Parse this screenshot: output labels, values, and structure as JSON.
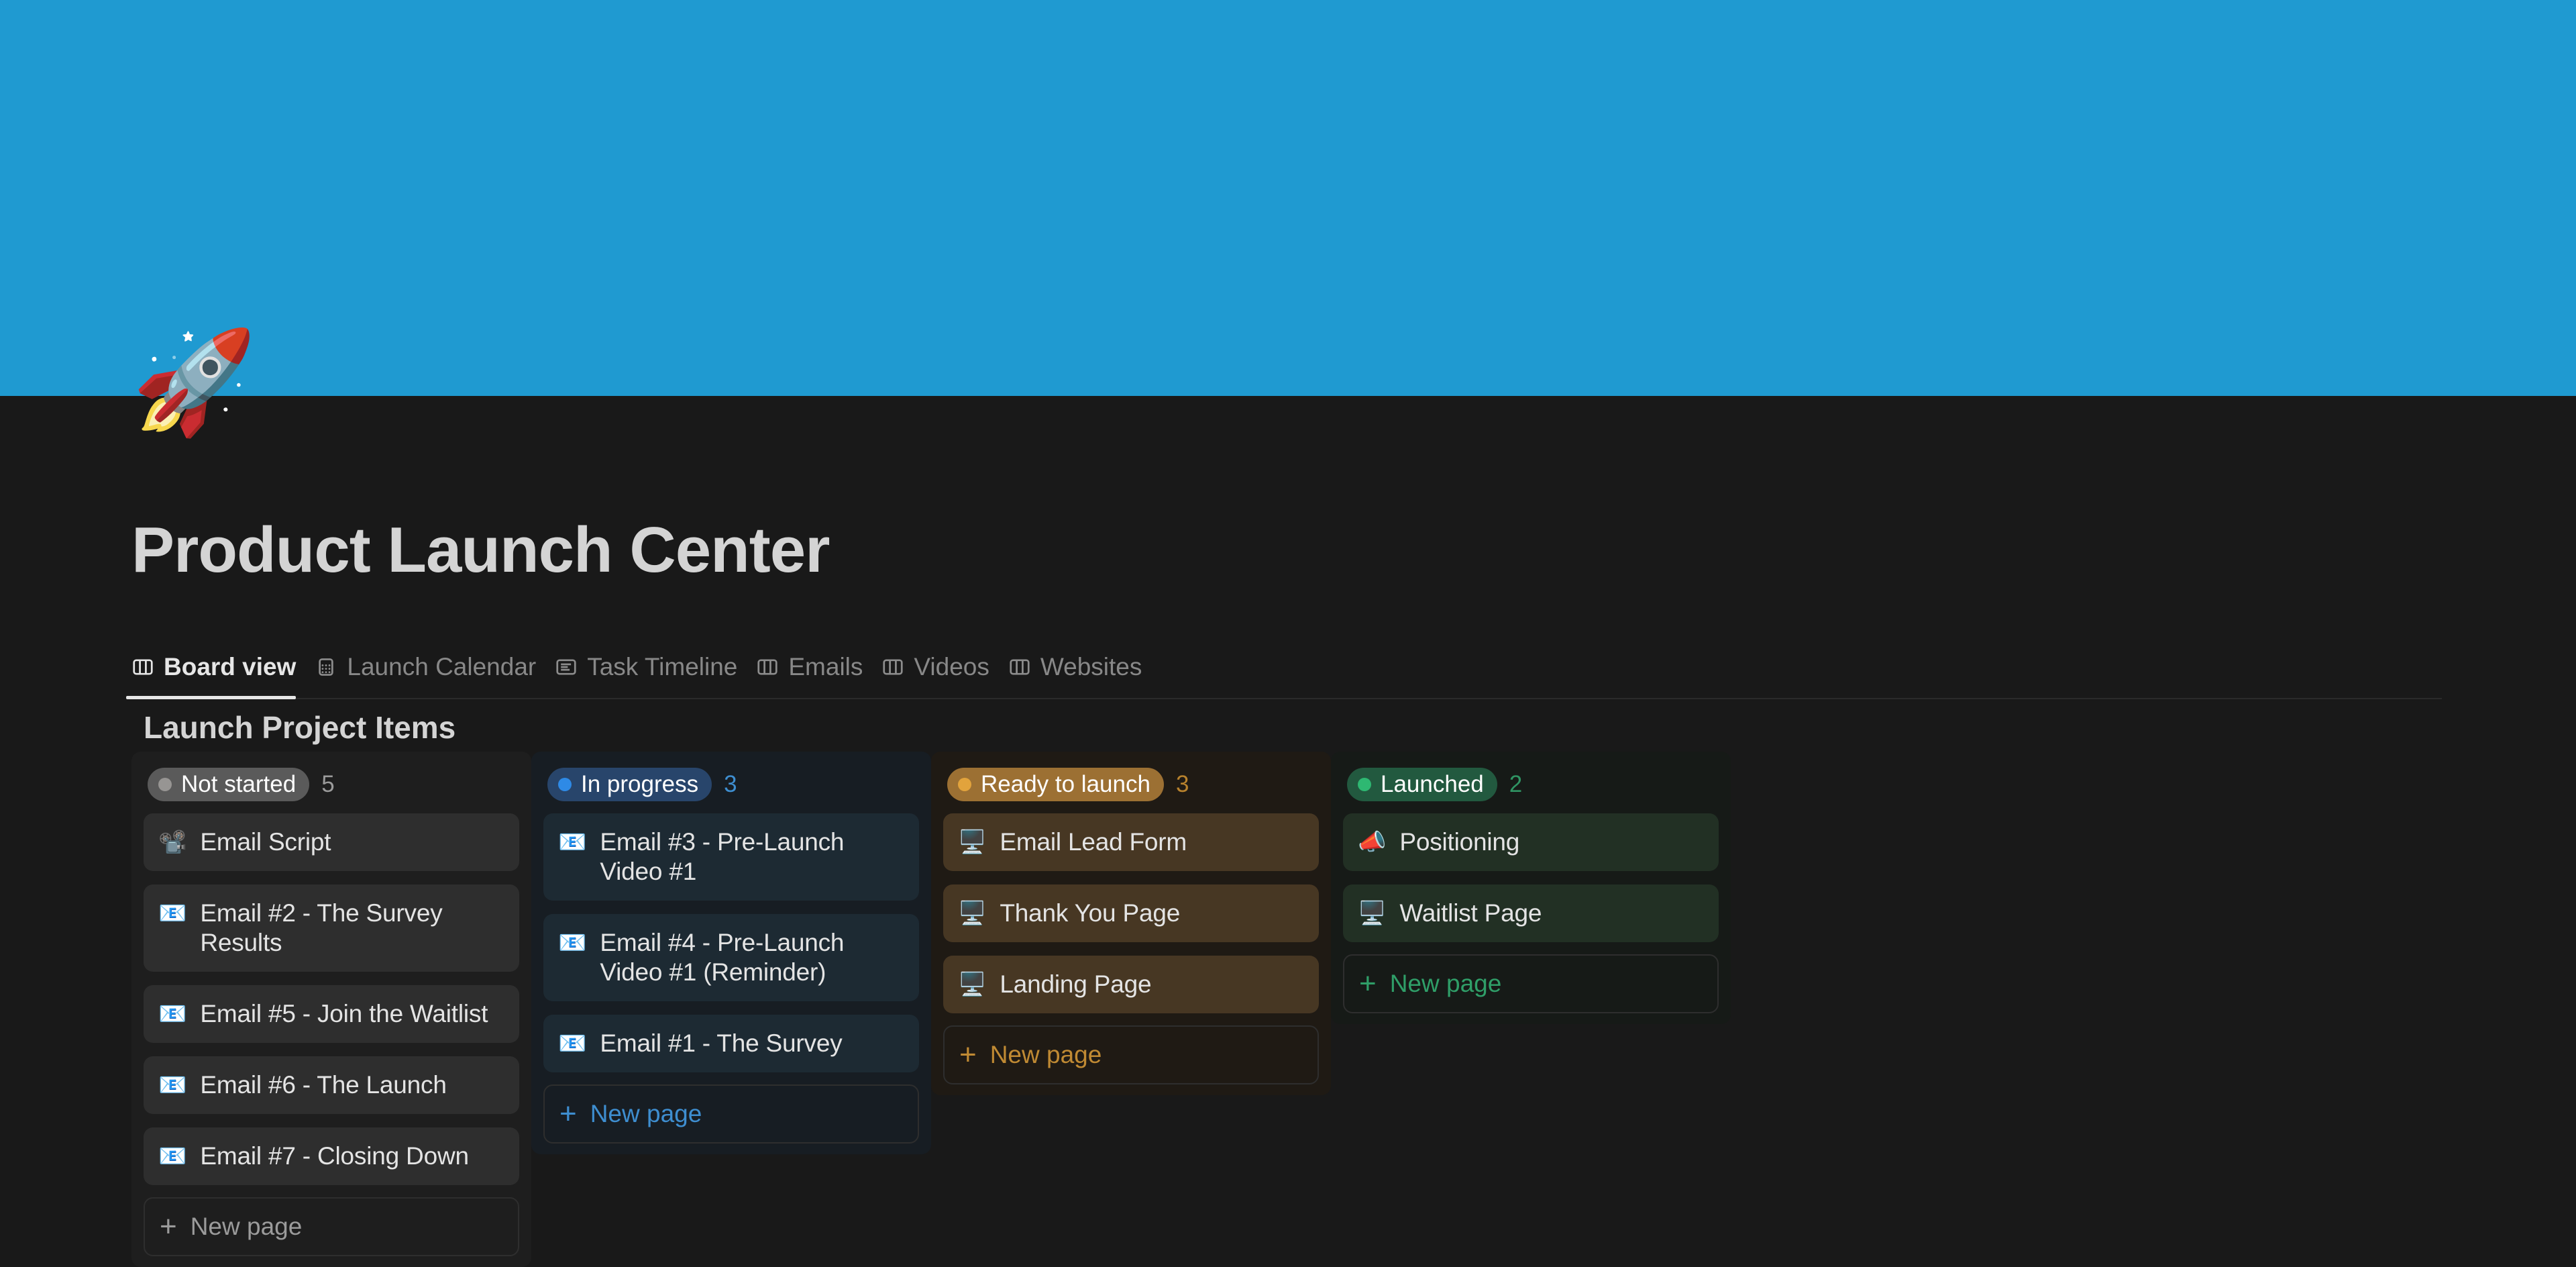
{
  "cover": {
    "color": "#1f9ad1"
  },
  "page": {
    "icon": "🚀",
    "icon_name": "rocket-emoji",
    "title": "Product Launch Center"
  },
  "tabs": [
    {
      "label": "Board view",
      "icon": "board-view-icon",
      "active": true
    },
    {
      "label": "Launch Calendar",
      "icon": "calendar-icon",
      "active": false
    },
    {
      "label": "Task Timeline",
      "icon": "timeline-icon",
      "active": false
    },
    {
      "label": "Emails",
      "icon": "board-view-icon",
      "active": false
    },
    {
      "label": "Videos",
      "icon": "board-view-icon",
      "active": false
    },
    {
      "label": "Websites",
      "icon": "board-view-icon",
      "active": false
    }
  ],
  "board": {
    "title": "Launch Project Items",
    "columns": [
      {
        "status": "Not started",
        "count": "5",
        "dot_color": "#979593",
        "pill_bg": "#5a5a5a",
        "pill_text": "#ffffff",
        "count_color": "#9b9b9b",
        "column_bg": "#1e1e1e",
        "card_bg": "#2e2e2e",
        "newpage_color": "#9b9b9b",
        "newpage_label": "New page",
        "cards": [
          {
            "emoji": "📽️",
            "icon_name": "film-projector-emoji",
            "title": "Email Script"
          },
          {
            "emoji": "📧",
            "icon_name": "email-emoji",
            "title": "Email #2 - The Survey Results"
          },
          {
            "emoji": "📧",
            "icon_name": "email-emoji",
            "title": "Email #5 - Join the Waitlist"
          },
          {
            "emoji": "📧",
            "icon_name": "email-emoji",
            "title": "Email #6 - The Launch"
          },
          {
            "emoji": "📧",
            "icon_name": "email-emoji",
            "title": "Email #7 - Closing Down"
          }
        ]
      },
      {
        "status": "In progress",
        "count": "3",
        "dot_color": "#2e8ae6",
        "pill_bg": "#28456b",
        "pill_text": "#ffffff",
        "count_color": "#3e8ed0",
        "column_bg": "#171d23",
        "card_bg": "#1d2a33",
        "newpage_color": "#3e8ed0",
        "newpage_label": "New page",
        "cards": [
          {
            "emoji": "📧",
            "icon_name": "email-emoji",
            "title": "Email #3 - Pre-Launch Video #1"
          },
          {
            "emoji": "📧",
            "icon_name": "email-emoji",
            "title": "Email #4 - Pre-Launch Video #1 (Reminder)"
          },
          {
            "emoji": "📧",
            "icon_name": "email-emoji",
            "title": "Email #1 - The Survey"
          }
        ]
      },
      {
        "status": "Ready to launch",
        "count": "3",
        "dot_color": "#e2a33c",
        "pill_bg": "#9c7033",
        "pill_text": "#ffffff",
        "count_color": "#b8822d",
        "column_bg": "#1f1a14",
        "card_bg": "#473723",
        "newpage_color": "#c08a33",
        "newpage_label": "New page",
        "cards": [
          {
            "emoji": "🖥️",
            "icon_name": "desktop-computer-emoji",
            "title": "Email Lead Form"
          },
          {
            "emoji": "🖥️",
            "icon_name": "desktop-computer-emoji",
            "title": "Thank You Page"
          },
          {
            "emoji": "🖥️",
            "icon_name": "desktop-computer-emoji",
            "title": "Landing Page"
          }
        ]
      },
      {
        "status": "Launched",
        "count": "2",
        "dot_color": "#2eb872",
        "pill_bg": "#22593f",
        "pill_text": "#ffffff",
        "count_color": "#2f9463",
        "column_bg": "#161a17",
        "column_bg2": "#1b241c",
        "card_bg": "#223024",
        "newpage_color": "#2f9e68",
        "newpage_label": "New page",
        "cards": [
          {
            "emoji": "📣",
            "icon_name": "megaphone-emoji",
            "title": "Positioning"
          },
          {
            "emoji": "🖥️",
            "icon_name": "desktop-computer-emoji",
            "title": "Waitlist Page"
          }
        ]
      }
    ]
  }
}
